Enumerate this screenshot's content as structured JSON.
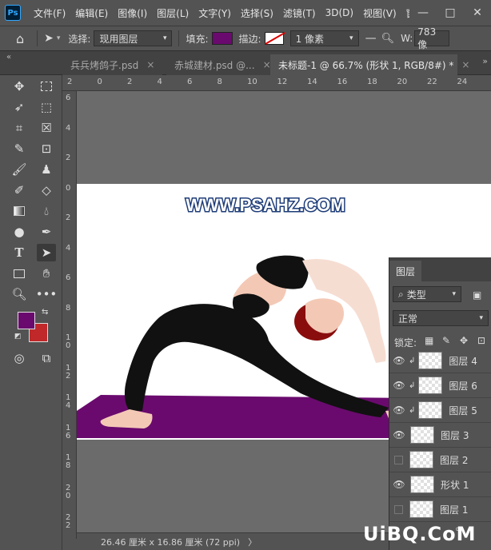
{
  "menubar": {
    "logo": "Ps",
    "items": [
      "文件(F)",
      "编辑(E)",
      "图像(I)",
      "图层(L)",
      "文字(Y)",
      "选择(S)",
      "滤镜(T)",
      "3D(D)",
      "视图(V)",
      "窗口"
    ],
    "window_buttons": [
      "—",
      "□",
      "✕"
    ]
  },
  "options": {
    "select_label": "选择:",
    "select_value": "现用图层",
    "fill_label": "填充:",
    "fill_color": "#6a0a6e",
    "stroke_label": "描边:",
    "stroke_size": "1 像素",
    "w_label": "W:",
    "w_value": "783 像"
  },
  "tabs": [
    {
      "label": "兵兵烤鸽子.psd",
      "close": "×"
    },
    {
      "label": "赤城建材.psd @...",
      "close": "×"
    },
    {
      "label": "未标题-1 @ 66.7% (形状 1, RGB/8#) *",
      "close": "×"
    }
  ],
  "ruler": {
    "top_labels": [
      "2",
      "0",
      "2",
      "4",
      "6",
      "8",
      "10",
      "12",
      "14",
      "16",
      "18",
      "20",
      "22",
      "24"
    ],
    "left_labels": [
      "6",
      "4",
      "2",
      "0",
      "2",
      "4",
      "6",
      "8",
      "1 0",
      "1 2",
      "1 4",
      "1 6",
      "1 8",
      "2 0",
      "2 2"
    ]
  },
  "canvas": {
    "watermark_text": "WWW.PSAHZ.COM",
    "mat_color": "#6a0a6e"
  },
  "tools": {
    "foreground_color": "#6a0a6e",
    "background_color": "#c0282a"
  },
  "status": {
    "text": "26.46 厘米 x 16.86 厘米 (72 ppi)",
    "arrow": "〉"
  },
  "layers_panel": {
    "tab_label": "图层",
    "kind_label": "类型",
    "blend_mode": "正常",
    "lock_label": "锁定:",
    "layers": [
      {
        "name": "图层 4",
        "visible": true,
        "clipped": true
      },
      {
        "name": "图层 6",
        "visible": true,
        "clipped": true
      },
      {
        "name": "图层 5",
        "visible": true,
        "clipped": true
      },
      {
        "name": "图层 3",
        "visible": true,
        "clipped": false
      },
      {
        "name": "图层 2",
        "visible": false,
        "clipped": false
      },
      {
        "name": "形状 1",
        "visible": true,
        "clipped": false
      },
      {
        "name": "图层 1",
        "visible": false,
        "clipped": false
      }
    ]
  },
  "site_watermark": "UiBQ.CoM"
}
